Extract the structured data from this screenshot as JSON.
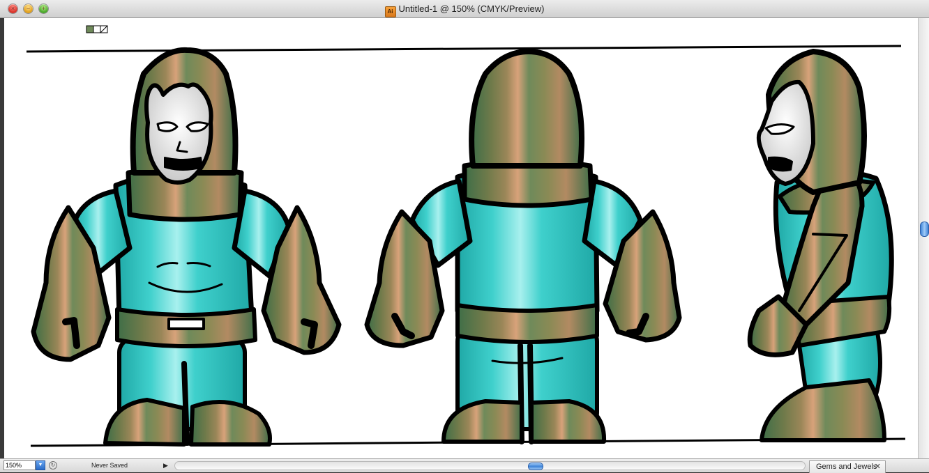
{
  "window": {
    "title": "Untitled-1 @ 150% (CMYK/Preview)",
    "app_icon_label": "Ai",
    "close_glyph": "×",
    "minimize_glyph": "−",
    "zoom_glyph": "+"
  },
  "artboard": {
    "artwork_description_hidden": "",
    "views": [
      "front",
      "back",
      "side"
    ]
  },
  "colors": {
    "teal_light": "#a8f0ee",
    "teal_mid": "#3fd0cc",
    "teal_dark": "#1fa8a6",
    "bronze_light": "#d8a27a",
    "bronze_mid": "#8a8a55",
    "bronze_dark": "#3e6e48",
    "skin": "#e6e6e6",
    "outline": "#000000"
  },
  "statusbar": {
    "zoom_value": "150%",
    "zoom_arrow": "▼",
    "status_icon": "↻",
    "status_text": "Never Saved",
    "status_menu_arrow": "▶"
  },
  "panel": {
    "tab_label": "Gems and Jewels",
    "close_glyph": "✕"
  }
}
